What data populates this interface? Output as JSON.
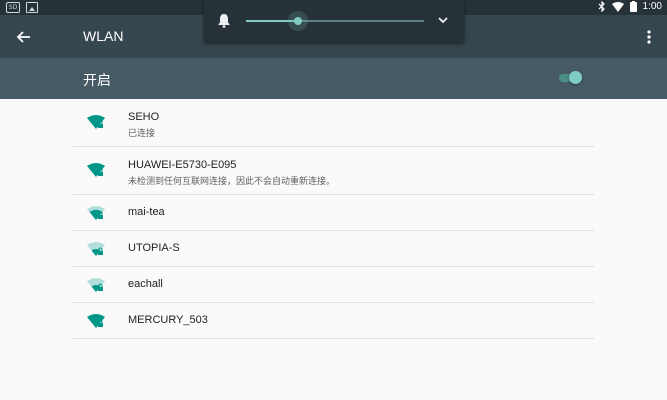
{
  "statusbar": {
    "badge": "SD",
    "time": "1:00"
  },
  "appbar": {
    "title": "WLAN"
  },
  "master_switch": {
    "label": "开启",
    "on": true
  },
  "volume": {
    "level": 0.29
  },
  "networks": [
    {
      "ssid": "SEHO",
      "status": "已连接",
      "signal": "full"
    },
    {
      "ssid": "HUAWEI-E5730-E095",
      "status": "未检测到任何互联网连接，因此不会自动重新连接。",
      "signal": "full"
    },
    {
      "ssid": "mai-tea",
      "status": "",
      "signal": "medium"
    },
    {
      "ssid": "UTOPIA-S",
      "status": "",
      "signal": "low"
    },
    {
      "ssid": "eachall",
      "status": "",
      "signal": "low"
    },
    {
      "ssid": "MERCURY_503",
      "status": "",
      "signal": "full"
    }
  ],
  "colors": {
    "accent": "#009688",
    "statusbar": "#263238",
    "appbar": "#37474f",
    "switchbar": "#455a64"
  }
}
